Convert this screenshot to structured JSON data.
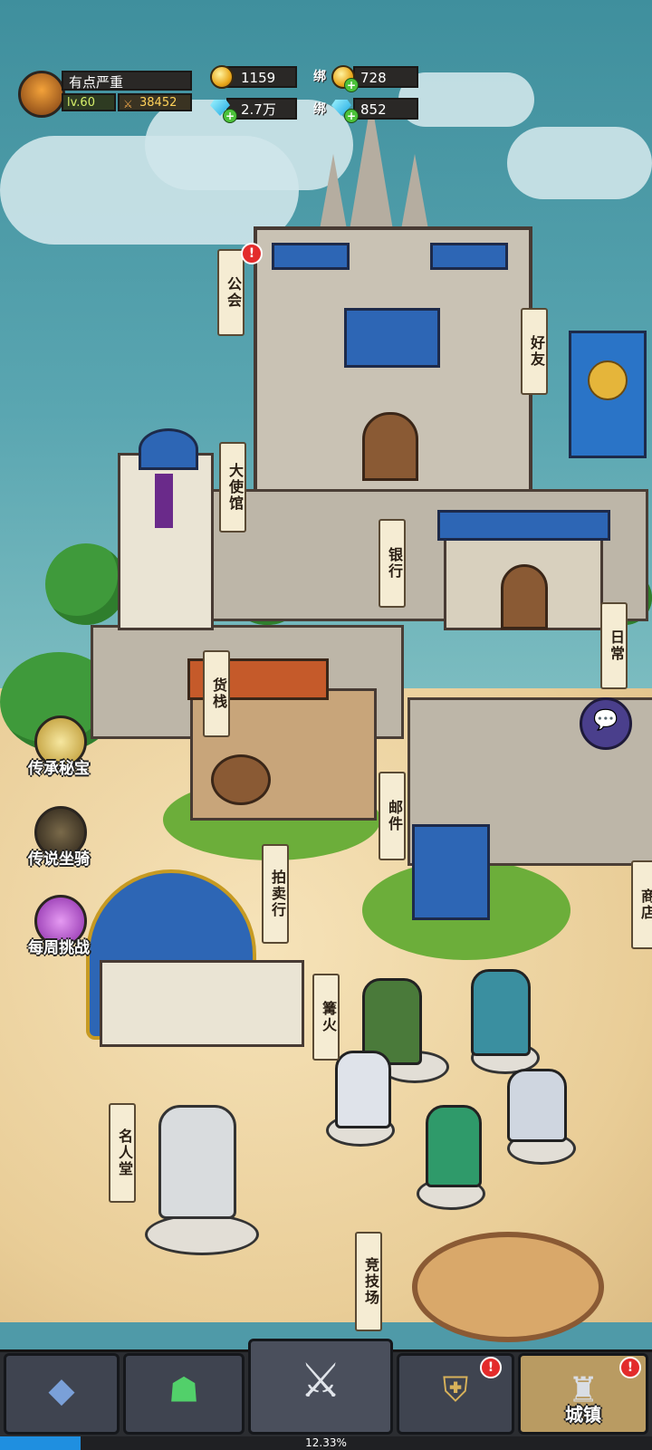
{
  "player": {
    "name": "有点严重",
    "level": "lv.60",
    "power": "38452"
  },
  "resources": {
    "gold": "1159",
    "bound_gold_label": "绑",
    "bound_gold": "728",
    "diamond": "2.7万",
    "bound_diamond_label": "绑",
    "bound_diamond": "852"
  },
  "buildings": {
    "guild": "公会",
    "friends": "好友",
    "embassy": "大使馆",
    "bank": "银行",
    "daily": "日常",
    "inn": "货栈",
    "mail": "邮件",
    "auction": "拍卖行",
    "shop": "商店",
    "bonfire": "篝火",
    "hall_of_fame": "名人堂",
    "arena": "竞技场"
  },
  "side_menu": {
    "legacy_treasure": "传承秘宝",
    "legendary_mount": "传说坐骑",
    "weekly_challenge": "每周挑战"
  },
  "badges": {
    "guild": "!",
    "tab_4": "!",
    "tab_town": "!"
  },
  "bottom_tabs": {
    "town": "城镇"
  },
  "progress": {
    "text": "12.33%",
    "fraction": 0.1233
  },
  "icons": {
    "avatar": "hero-avatar-icon",
    "chat": "chat-bubble-icon"
  },
  "colors": {
    "gold": "#e9a81d",
    "diamond": "#1aa6e0",
    "badge": "#e32b2b",
    "progress": "#1f8fe0"
  }
}
